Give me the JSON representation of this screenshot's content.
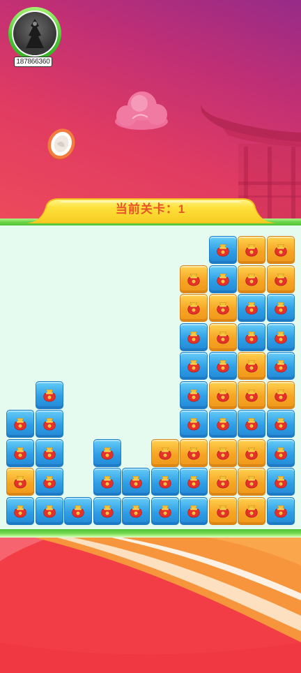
{
  "user": {
    "id": "187866360"
  },
  "level": {
    "prefix": "当前关卡：",
    "number": "1"
  },
  "board": {
    "tile_icon": "money-bag-icon",
    "tiles": [
      [
        null,
        null,
        null,
        null,
        null,
        null,
        null,
        "blue",
        "orange",
        "orange"
      ],
      [
        null,
        null,
        null,
        null,
        null,
        null,
        "orange",
        "blue",
        "orange",
        "orange"
      ],
      [
        null,
        null,
        null,
        null,
        null,
        null,
        "orange",
        "orange",
        "blue",
        "blue"
      ],
      [
        null,
        null,
        null,
        null,
        null,
        null,
        "blue",
        "orange",
        "blue",
        "blue"
      ],
      [
        null,
        null,
        null,
        null,
        null,
        null,
        "blue",
        "blue",
        "orange",
        "blue"
      ],
      [
        null,
        "blue",
        null,
        null,
        null,
        null,
        "blue",
        "orange",
        "orange",
        "orange"
      ],
      [
        "blue",
        "blue",
        null,
        null,
        null,
        null,
        "blue",
        "blue",
        "blue",
        "blue"
      ],
      [
        "blue",
        "blue",
        null,
        "blue",
        null,
        "orange",
        "orange",
        "orange",
        "orange",
        "blue"
      ],
      [
        "orange",
        "blue",
        null,
        "blue",
        "blue",
        "blue",
        "blue",
        "orange",
        "orange",
        "blue"
      ],
      [
        "blue",
        "blue",
        "blue",
        "blue",
        "blue",
        "blue",
        "blue",
        "orange",
        "orange",
        "blue"
      ]
    ]
  },
  "icons": {
    "avatar": "avatar",
    "coin": "coin-icon",
    "cloud": "cloud-decoration",
    "pavilion": "pavilion-decoration"
  },
  "colors": {
    "tile_blue": "#2e9ee6",
    "tile_orange": "#f6a424",
    "level_text": "#e9532a",
    "banner": "#fde13a",
    "board_bg": "#e5fbf0",
    "border_green": "#6fd64c",
    "bag_red": "#e5312a"
  }
}
